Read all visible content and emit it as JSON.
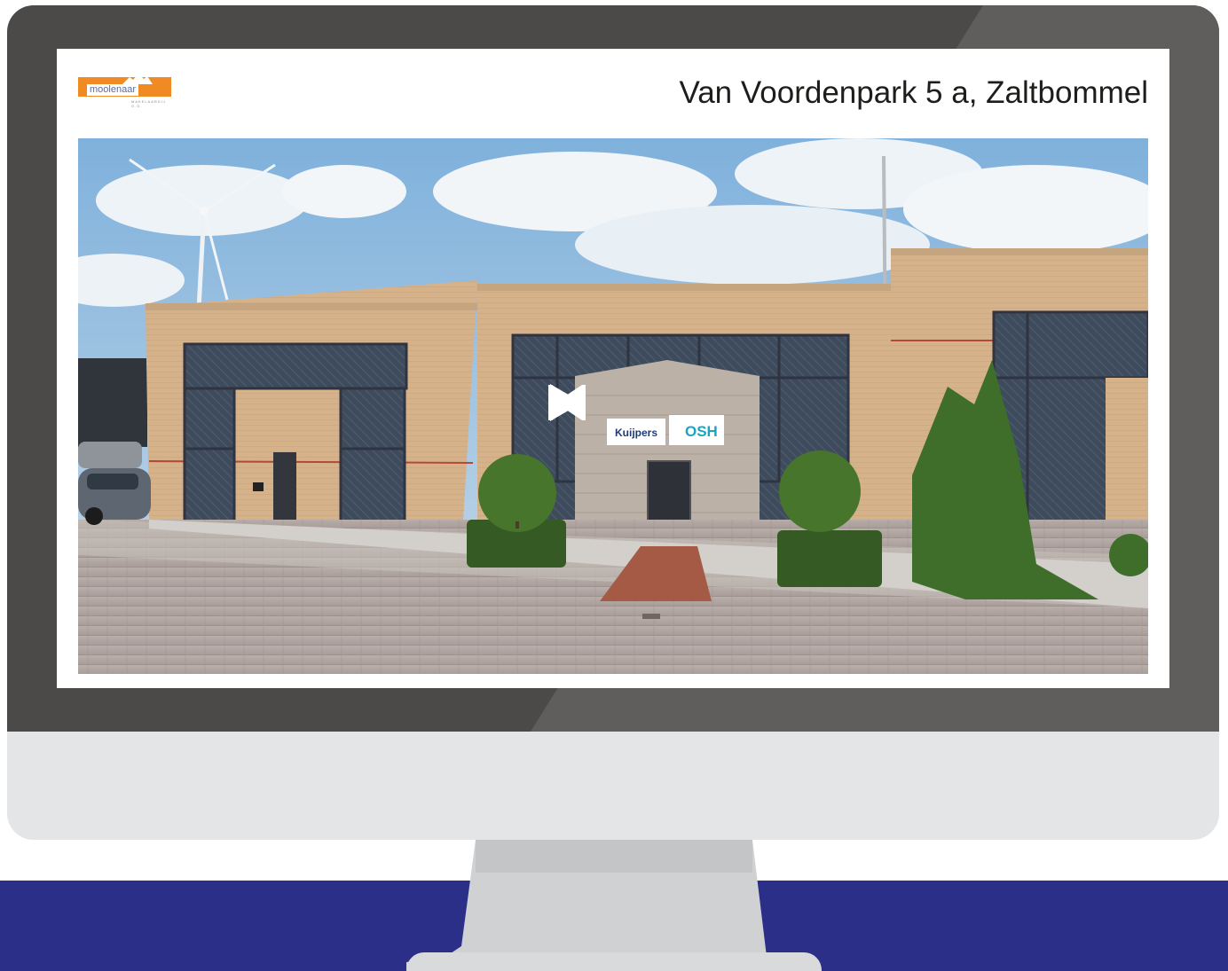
{
  "page": {
    "address": "Van Voordenpark 5 a, Zaltbommel"
  },
  "logo": {
    "name": "moolenaar",
    "tagline": "MAKELAARDIJ O.G."
  },
  "signs": {
    "left": "Kuijpers",
    "right": "OSH"
  },
  "player": {
    "prev_icon": "skip-previous-icon",
    "play_icon": "play-icon",
    "next_icon": "skip-next-icon"
  },
  "colors": {
    "bezel": "#4b4a49",
    "chin": "#e4e5e7",
    "navy_band": "#2b2f87",
    "logo_orange": "#f08a23"
  }
}
